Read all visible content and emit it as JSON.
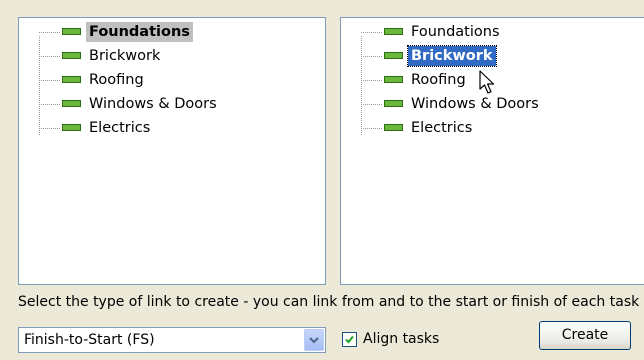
{
  "left_tree": {
    "items": [
      {
        "label": "Foundations"
      },
      {
        "label": "Brickwork"
      },
      {
        "label": "Roofing"
      },
      {
        "label": "Windows & Doors"
      },
      {
        "label": "Electrics"
      }
    ]
  },
  "right_tree": {
    "items": [
      {
        "label": "Foundations"
      },
      {
        "label": "Brickwork"
      },
      {
        "label": "Roofing"
      },
      {
        "label": "Windows & Doors"
      },
      {
        "label": "Electrics"
      }
    ]
  },
  "instruction": "Select the type of link to create - you can link from and to the start or finish of each task",
  "link_type": {
    "selected": "Finish-to-Start (FS)"
  },
  "align_tasks": {
    "label": "Align tasks",
    "checked": true
  },
  "create_button": {
    "label": "Create"
  },
  "colors": {
    "task_icon": "#6cb83a",
    "selection_blue": "#316ac5",
    "selection_gray": "#c0c0c0"
  }
}
